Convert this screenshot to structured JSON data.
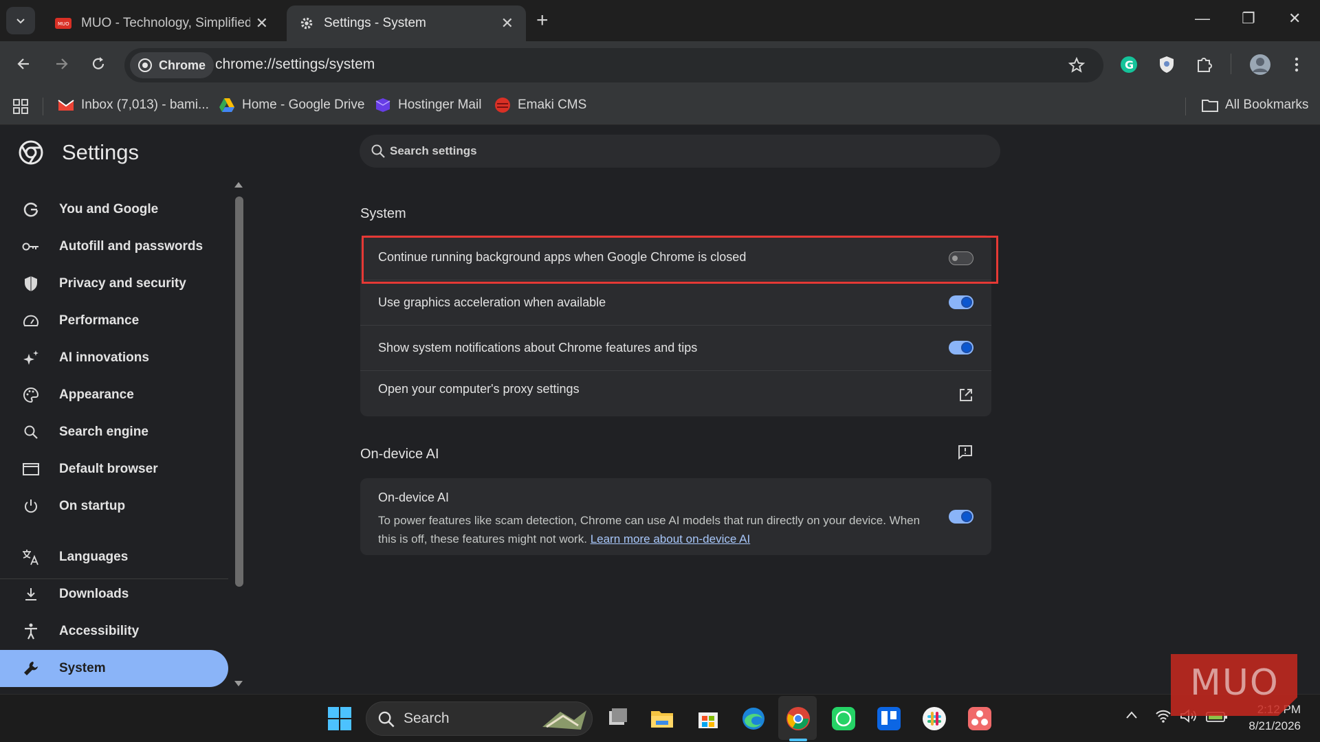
{
  "tabs": [
    {
      "title": "MUO - Technology, Simplified.",
      "favicon": "muo-favicon",
      "active": false
    },
    {
      "title": "Settings - System",
      "favicon": "gear-icon",
      "active": true
    }
  ],
  "toolbar": {
    "chip_label": "Chrome",
    "url": "chrome://settings/system"
  },
  "bookmarks": {
    "items": [
      {
        "label": "Inbox (7,013) - bami...",
        "icon": "gmail-icon"
      },
      {
        "label": "Home - Google Drive",
        "icon": "drive-icon"
      },
      {
        "label": "Hostinger Mail",
        "icon": "hostinger-icon"
      },
      {
        "label": "Emaki CMS",
        "icon": "emaki-icon"
      }
    ],
    "all_label": "All Bookmarks"
  },
  "settings": {
    "title": "Settings",
    "search_placeholder": "Search settings"
  },
  "sidebar": {
    "items": [
      {
        "label": "You and Google",
        "icon": "google-icon"
      },
      {
        "label": "Autofill and passwords",
        "icon": "key-icon"
      },
      {
        "label": "Privacy and security",
        "icon": "shield-icon"
      },
      {
        "label": "Performance",
        "icon": "speedometer-icon"
      },
      {
        "label": "AI innovations",
        "icon": "sparkle-icon"
      },
      {
        "label": "Appearance",
        "icon": "palette-icon"
      },
      {
        "label": "Search engine",
        "icon": "search-icon"
      },
      {
        "label": "Default browser",
        "icon": "browser-window-icon"
      },
      {
        "label": "On startup",
        "icon": "power-icon"
      },
      {
        "label": "Languages",
        "icon": "translate-icon"
      },
      {
        "label": "Downloads",
        "icon": "download-icon"
      },
      {
        "label": "Accessibility",
        "icon": "accessibility-icon"
      },
      {
        "label": "System",
        "icon": "wrench-icon",
        "active": true
      }
    ]
  },
  "system": {
    "section_title": "System",
    "rows": [
      {
        "label": "Continue running background apps when Google Chrome is closed",
        "enabled": false
      },
      {
        "label": "Use graphics acceleration when available",
        "enabled": true
      },
      {
        "label": "Show system notifications about Chrome features and tips",
        "enabled": true
      },
      {
        "label": "Open your computer's proxy settings",
        "icon": "external-link-icon"
      }
    ]
  },
  "on_device_ai": {
    "section_title": "On-device AI",
    "row_title": "On-device AI",
    "description": "To power features like scam detection, Chrome can use AI models that run directly on your device. When this is off, these features might not work.",
    "link_text": "Learn more about on-device AI",
    "enabled": true
  },
  "taskbar": {
    "search_label": "Search",
    "time": "2:12 PM",
    "date": "8/21/2026"
  },
  "watermark": "MUO",
  "colors": {
    "accent": "#8ab4f8",
    "highlight_border": "#e53935",
    "background": "#202124"
  }
}
